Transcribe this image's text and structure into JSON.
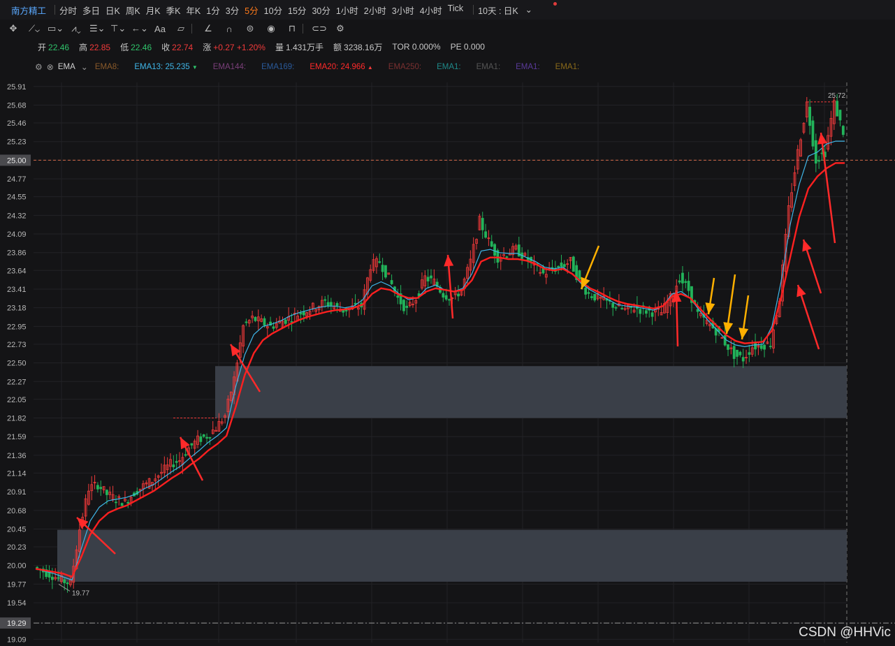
{
  "period_bar": {
    "stock_name": "南方精工",
    "periods": [
      "分时",
      "多日",
      "日K",
      "周K",
      "月K",
      "季K",
      "年K",
      "1分",
      "3分",
      "5分",
      "10分",
      "15分",
      "30分",
      "1小时",
      "2小时",
      "3小时",
      "4小时",
      "Tick"
    ],
    "active_period": "5分",
    "range_selector": "10天 : 日K",
    "dropdown_icon": "chevron-down-icon"
  },
  "toolbar": {
    "tools": [
      "move-icon",
      "line-icon",
      "rect-icon",
      "wave-icon",
      "fib-icon",
      "pitchfork-icon",
      "arrow-icon",
      "text-icon",
      "comment-icon",
      "pen-icon",
      "magnet-icon",
      "lock-icon",
      "eye-icon",
      "trash-icon",
      "link-icon",
      "settings-icon"
    ],
    "text_tool_label": "Aa"
  },
  "quote": {
    "open_label": "开",
    "open": "22.46",
    "high_label": "高",
    "high": "22.85",
    "low_label": "低",
    "low": "22.46",
    "close_label": "收",
    "close": "22.74",
    "change_label": "涨",
    "change": "+0.27",
    "change_pct": "+1.20%",
    "volume_label": "量",
    "volume": "1.431万手",
    "amount_label": "额",
    "amount": "3238.16万",
    "tor": "TOR 0.000%",
    "pe": "PE 0.000"
  },
  "ema_bar": {
    "title": "EMA",
    "items": [
      {
        "label": "EMA8:",
        "value": "",
        "color": "#8a5a2a"
      },
      {
        "label": "EMA13:",
        "value": "25.235",
        "color": "#3fb6e8",
        "arrow": "▼"
      },
      {
        "label": "EMA144:",
        "value": "",
        "color": "#7a3f7a"
      },
      {
        "label": "EMA169:",
        "value": "",
        "color": "#2a5a9a"
      },
      {
        "label": "EMA20:",
        "value": "24.966",
        "color": "#ff2a2a",
        "arrow": "▲"
      },
      {
        "label": "EMA250:",
        "value": "",
        "color": "#7a3030"
      },
      {
        "label": "EMA1:",
        "value": "",
        "color": "#1f8a8a"
      },
      {
        "label": "EMA1:",
        "value": "",
        "color": "#555555"
      },
      {
        "label": "EMA1:",
        "value": "",
        "color": "#5a3a9a"
      },
      {
        "label": "EMA1:",
        "value": "",
        "color": "#8a6a1a"
      }
    ]
  },
  "chart_data": {
    "type": "candlestick",
    "y_ticks": [
      "25.91",
      "25.68",
      "25.46",
      "25.23",
      "25.00",
      "24.77",
      "24.55",
      "24.32",
      "24.09",
      "23.86",
      "23.64",
      "23.41",
      "23.18",
      "22.95",
      "22.73",
      "22.50",
      "22.27",
      "22.05",
      "21.82",
      "21.59",
      "21.36",
      "21.14",
      "20.91",
      "20.68",
      "20.45",
      "20.23",
      "20.00",
      "19.77",
      "19.54",
      "19.29",
      "19.09"
    ],
    "ylim": [
      19.05,
      25.96
    ],
    "highlight_levels": [
      "25.00",
      "19.29"
    ],
    "max_label": "25.72",
    "min_label": "19.77",
    "zones": [
      [
        21.82,
        22.46
      ],
      [
        19.8,
        20.44
      ]
    ],
    "close_path": [
      19.98,
      19.93,
      19.88,
      19.82,
      19.78,
      20.45,
      20.95,
      21.0,
      20.88,
      20.82,
      20.78,
      20.9,
      20.98,
      21.05,
      21.15,
      21.25,
      21.3,
      21.45,
      21.55,
      21.6,
      21.7,
      21.85,
      22.3,
      22.95,
      23.05,
      23.0,
      22.95,
      23.0,
      23.05,
      23.1,
      23.15,
      23.2,
      23.25,
      23.2,
      23.15,
      23.18,
      23.2,
      23.7,
      23.75,
      23.55,
      23.3,
      23.15,
      23.3,
      23.55,
      23.5,
      23.35,
      23.3,
      23.4,
      23.75,
      24.25,
      24.0,
      23.8,
      23.85,
      23.9,
      23.8,
      23.7,
      23.6,
      23.65,
      23.7,
      23.75,
      23.5,
      23.35,
      23.3,
      23.25,
      23.2,
      23.15,
      23.18,
      23.15,
      23.13,
      23.12,
      23.3,
      23.55,
      23.4,
      23.1,
      23.0,
      22.9,
      22.75,
      22.6,
      22.55,
      22.7,
      22.72,
      22.74,
      23.3,
      24.4,
      25.1,
      25.7,
      25.0,
      25.1,
      25.7,
      25.35
    ],
    "ema13": [
      19.96,
      19.93,
      19.9,
      19.86,
      19.82,
      20.2,
      20.55,
      20.72,
      20.8,
      20.82,
      20.84,
      20.88,
      20.95,
      21.0,
      21.08,
      21.16,
      21.23,
      21.33,
      21.42,
      21.52,
      21.6,
      21.7,
      22.2,
      22.6,
      22.85,
      22.95,
      22.98,
      23.02,
      23.08,
      23.12,
      23.15,
      23.18,
      23.2,
      23.2,
      23.18,
      23.2,
      23.28,
      23.45,
      23.5,
      23.45,
      23.35,
      23.28,
      23.3,
      23.42,
      23.46,
      23.4,
      23.38,
      23.42,
      23.6,
      23.88,
      23.9,
      23.86,
      23.85,
      23.85,
      23.8,
      23.75,
      23.68,
      23.66,
      23.68,
      23.6,
      23.48,
      23.4,
      23.34,
      23.28,
      23.22,
      23.2,
      23.19,
      23.17,
      23.15,
      23.2,
      23.35,
      23.38,
      23.3,
      23.15,
      23.02,
      22.9,
      22.78,
      22.72,
      22.7,
      22.72,
      22.73,
      22.95,
      23.5,
      24.2,
      24.7,
      25.05,
      25.1,
      25.2,
      25.235,
      25.235
    ],
    "ema20": [
      19.96,
      19.94,
      19.92,
      19.9,
      19.86,
      20.1,
      20.38,
      20.55,
      20.65,
      20.7,
      20.74,
      20.8,
      20.86,
      20.92,
      21.0,
      21.08,
      21.15,
      21.24,
      21.32,
      21.42,
      21.5,
      21.6,
      21.95,
      22.35,
      22.62,
      22.78,
      22.86,
      22.92,
      22.98,
      23.03,
      23.07,
      23.1,
      23.13,
      23.15,
      23.16,
      23.18,
      23.22,
      23.35,
      23.42,
      23.4,
      23.34,
      23.3,
      23.3,
      23.38,
      23.42,
      23.4,
      23.38,
      23.4,
      23.52,
      23.75,
      23.8,
      23.8,
      23.78,
      23.78,
      23.76,
      23.72,
      23.66,
      23.64,
      23.66,
      23.6,
      23.5,
      23.42,
      23.37,
      23.31,
      23.26,
      23.23,
      23.21,
      23.19,
      23.17,
      23.2,
      23.32,
      23.35,
      23.3,
      23.18,
      23.06,
      22.95,
      22.84,
      22.77,
      22.74,
      22.75,
      22.76,
      22.9,
      23.3,
      23.8,
      24.3,
      24.65,
      24.8,
      24.9,
      24.966,
      24.966
    ]
  },
  "annotations": {
    "red_arrows": 10,
    "yellow_arrows": 5
  },
  "watermark": "CSDN @HHVic"
}
